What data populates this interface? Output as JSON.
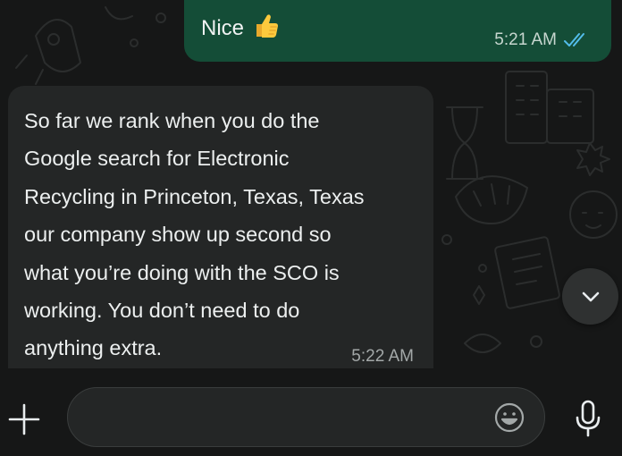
{
  "chat": {
    "outgoing": {
      "text": "Nice",
      "emoji_icon": "thumbs-up-icon",
      "time": "5:21 AM",
      "status_icon": "double-check-icon",
      "status_color": "#53bdeb"
    },
    "incoming": {
      "lines": [
        "So far we rank when you do the",
        "Google search for Electronic",
        "Recycling in Princeton, Texas, Texas",
        "our company show up second so",
        "what you’re doing with the SCO is",
        "working. You don’t need to do",
        "anything extra."
      ],
      "time": "5:22 AM"
    },
    "scroll_button_icon": "chevron-down-icon"
  },
  "composer": {
    "attach_icon": "plus-icon",
    "input_value": "",
    "input_placeholder": "",
    "emoji_icon": "smiley-icon",
    "mic_icon": "microphone-icon"
  },
  "colors": {
    "background": "#161717",
    "outgoing_bubble": "#144d37",
    "incoming_bubble": "#242626",
    "input_background": "#242626"
  }
}
